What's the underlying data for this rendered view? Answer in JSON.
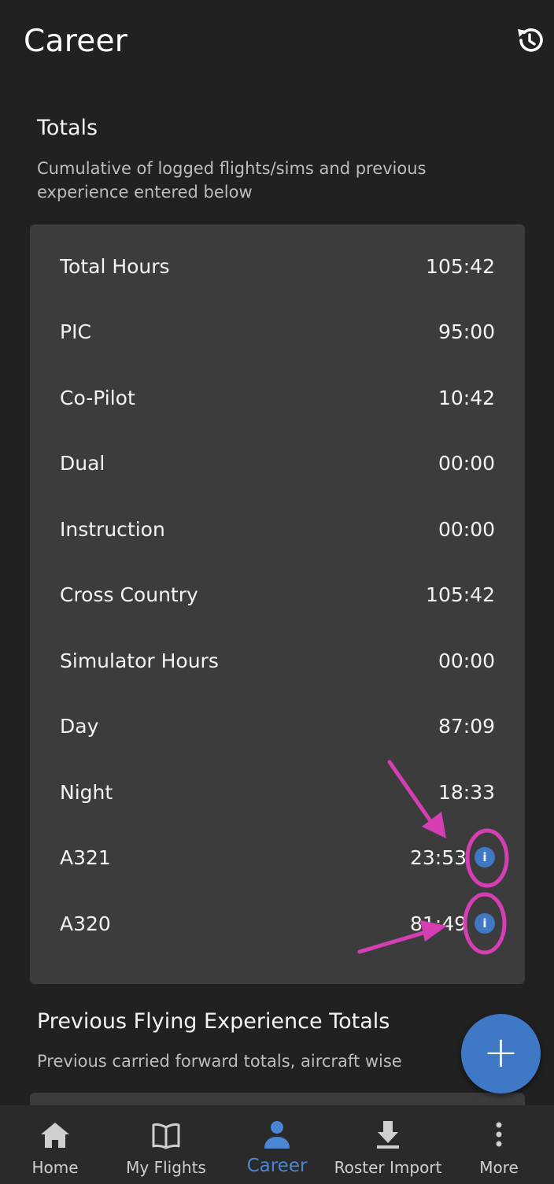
{
  "appbar": {
    "title": "Career",
    "history_icon": "history-icon"
  },
  "totals": {
    "title": "Totals",
    "subtitle": "Cumulative of logged flights/sims and previous experience entered below",
    "rows": [
      {
        "label": "Total Hours",
        "value": "105:42"
      },
      {
        "label": "PIC",
        "value": "95:00"
      },
      {
        "label": "Co-Pilot",
        "value": "10:42"
      },
      {
        "label": "Dual",
        "value": "00:00"
      },
      {
        "label": "Instruction",
        "value": "00:00"
      },
      {
        "label": "Cross Country",
        "value": "105:42"
      },
      {
        "label": "Simulator Hours",
        "value": "00:00"
      },
      {
        "label": "Day",
        "value": "87:09"
      },
      {
        "label": "Night",
        "value": "18:33"
      },
      {
        "label": "A321",
        "value": "23:53",
        "info": "i"
      },
      {
        "label": "A320",
        "value": "81:49",
        "info": "i"
      }
    ]
  },
  "previous": {
    "title": "Previous Flying Experience Totals",
    "subtitle": "Previous carried forward totals, aircraft wise"
  },
  "fab": {
    "label": "+",
    "icon": "plus-icon"
  },
  "nav": {
    "items": [
      {
        "label": "Home",
        "icon": "home-icon"
      },
      {
        "label": "My Flights",
        "icon": "book-icon"
      },
      {
        "label": "Career",
        "icon": "person-icon",
        "active": true
      },
      {
        "label": "Roster Import",
        "icon": "download-icon"
      },
      {
        "label": "More",
        "icon": "more-vertical-icon"
      }
    ]
  },
  "colors": {
    "background": "#212121",
    "card": "#3c3c3c",
    "accent": "#3f79c6",
    "annotation": "#d63fb3"
  }
}
